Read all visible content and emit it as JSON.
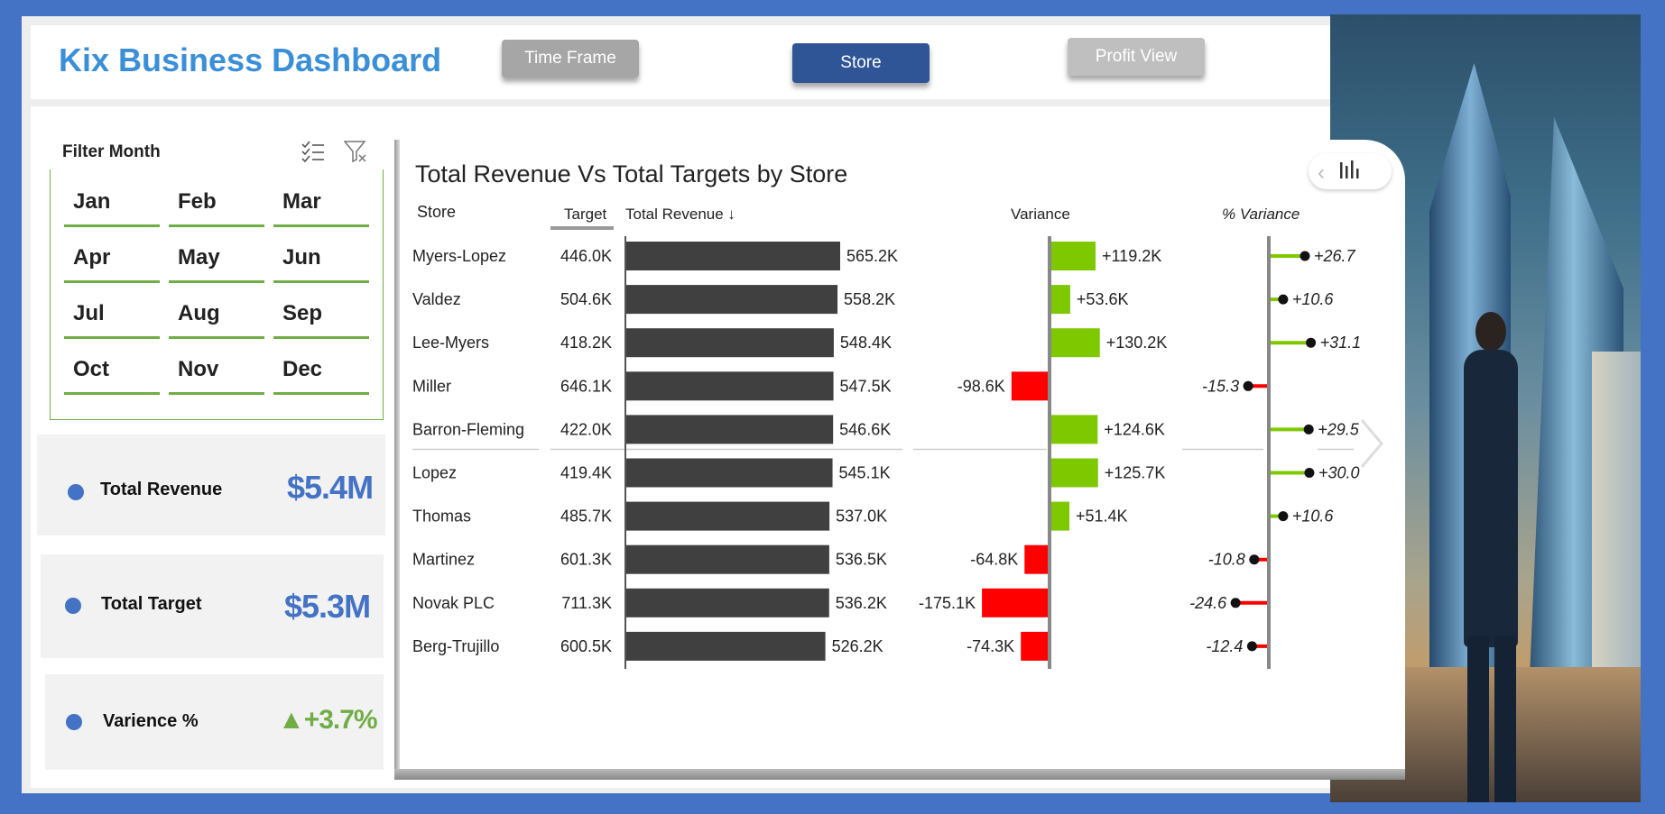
{
  "header": {
    "title": "Kix Business Dashboard",
    "nav": [
      {
        "label": "Time Frame",
        "state": "inactive"
      },
      {
        "label": "Store",
        "state": "active"
      },
      {
        "label": "Profit View",
        "state": "inactive"
      }
    ]
  },
  "filter": {
    "title": "Filter Month",
    "months": [
      "Jan",
      "Feb",
      "Mar",
      "Apr",
      "May",
      "Jun",
      "Jul",
      "Aug",
      "Sep",
      "Oct",
      "Nov",
      "Dec"
    ]
  },
  "kpis": [
    {
      "label": "Total Revenue",
      "value": "$5.4M"
    },
    {
      "label": "Total Target",
      "value": "$5.3M"
    },
    {
      "label": "Varience %",
      "value": "▲+3.7%"
    }
  ],
  "chart": {
    "title": "Total Revenue Vs Total Targets by Store",
    "headers": {
      "store": "Store",
      "target": "Target",
      "revenue": "Total Revenue ↓",
      "variance": "Variance",
      "pct_variance": "% Variance"
    }
  },
  "chart_data": {
    "type": "table",
    "columns": [
      "Store",
      "Target",
      "Total Revenue",
      "Variance",
      "% Variance"
    ],
    "rows": [
      {
        "store": "Myers-Lopez",
        "target": "446.0K",
        "revenue": 565.2,
        "revenue_label": "565.2K",
        "variance": 119.2,
        "variance_label": "+119.2K",
        "pct": 26.7,
        "pct_label": "+26.7"
      },
      {
        "store": "Valdez",
        "target": "504.6K",
        "revenue": 558.2,
        "revenue_label": "558.2K",
        "variance": 53.6,
        "variance_label": "+53.6K",
        "pct": 10.6,
        "pct_label": "+10.6"
      },
      {
        "store": "Lee-Myers",
        "target": "418.2K",
        "revenue": 548.4,
        "revenue_label": "548.4K",
        "variance": 130.2,
        "variance_label": "+130.2K",
        "pct": 31.1,
        "pct_label": "+31.1"
      },
      {
        "store": "Miller",
        "target": "646.1K",
        "revenue": 547.5,
        "revenue_label": "547.5K",
        "variance": -98.6,
        "variance_label": "-98.6K",
        "pct": -15.3,
        "pct_label": "-15.3"
      },
      {
        "store": "Barron-Fleming",
        "target": "422.0K",
        "revenue": 546.6,
        "revenue_label": "546.6K",
        "variance": 124.6,
        "variance_label": "+124.6K",
        "pct": 29.5,
        "pct_label": "+29.5"
      },
      {
        "store": "Lopez",
        "target": "419.4K",
        "revenue": 545.1,
        "revenue_label": "545.1K",
        "variance": 125.7,
        "variance_label": "+125.7K",
        "pct": 30.0,
        "pct_label": "+30.0"
      },
      {
        "store": "Thomas",
        "target": "485.7K",
        "revenue": 537.0,
        "revenue_label": "537.0K",
        "variance": 51.4,
        "variance_label": "+51.4K",
        "pct": 10.6,
        "pct_label": "+10.6"
      },
      {
        "store": "Martinez",
        "target": "601.3K",
        "revenue": 536.5,
        "revenue_label": "536.5K",
        "variance": -64.8,
        "variance_label": "-64.8K",
        "pct": -10.8,
        "pct_label": "-10.8"
      },
      {
        "store": "Novak PLC",
        "target": "711.3K",
        "revenue": 536.2,
        "revenue_label": "536.2K",
        "variance": -175.1,
        "variance_label": "-175.1K",
        "pct": -24.6,
        "pct_label": "-24.6"
      },
      {
        "store": "Berg-Trujillo",
        "target": "600.5K",
        "revenue": 526.2,
        "revenue_label": "526.2K",
        "variance": -74.3,
        "variance_label": "-74.3K",
        "pct": -12.4,
        "pct_label": "-12.4"
      }
    ]
  },
  "colors": {
    "accent": "#4472c4",
    "active_button": "#2f5597",
    "inactive_button": "#a6a6a6",
    "positive": "#7ec800",
    "negative": "#ff0000",
    "revenue_bar": "#404040",
    "month_underline": "#70ad47"
  },
  "icons": [
    "checklist-icon",
    "clear-filter-icon",
    "chevron-left-icon",
    "bar-chart-icon",
    "chevron-right-icon"
  ]
}
